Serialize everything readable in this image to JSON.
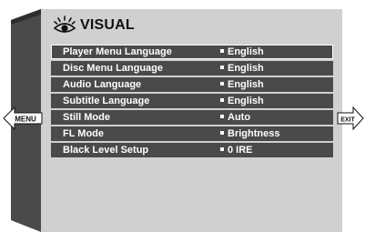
{
  "screen": {
    "title": "VISUAL",
    "title_icon": "eye-icon"
  },
  "settings": [
    {
      "label": "Player Menu Language",
      "value": "English"
    },
    {
      "label": "Disc Menu Language",
      "value": "English"
    },
    {
      "label": "Audio Language",
      "value": "English"
    },
    {
      "label": "Subtitle Language",
      "value": "English"
    },
    {
      "label": "Still Mode",
      "value": "Auto"
    },
    {
      "label": "FL Mode",
      "value": "Brightness"
    },
    {
      "label": "Black Level Setup",
      "value": "0 IRE"
    }
  ],
  "selected_index": 0,
  "nav": {
    "back_label": "MENU",
    "exit_label": "EXIT"
  },
  "colors": {
    "panel": "#d0d0d0",
    "row": "#4a4a4a",
    "left_bar_dark": "#3a3a3a",
    "left_bar_light": "#a0a0a0"
  }
}
